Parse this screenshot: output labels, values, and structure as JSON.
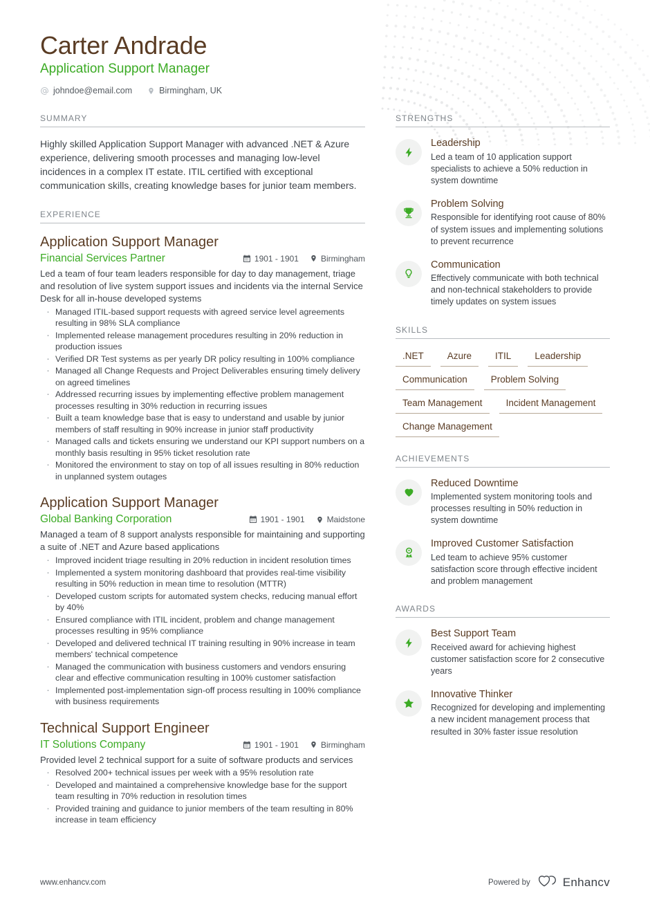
{
  "header": {
    "name": "Carter Andrade",
    "title": "Application Support Manager",
    "email": "johndoe@email.com",
    "email_icon": "at-icon",
    "location": "Birmingham, UK",
    "location_icon": "map-pin-icon"
  },
  "sections": {
    "summary_title": "SUMMARY",
    "experience_title": "EXPERIENCE",
    "strengths_title": "STRENGTHS",
    "skills_title": "SKILLS",
    "achievements_title": "ACHIEVEMENTS",
    "awards_title": "AWARDS"
  },
  "summary": {
    "text": "Highly skilled Application Support Manager with advanced .NET & Azure experience, delivering smooth processes and managing low-level incidences in a complex IT estate. ITIL certified with exceptional communication skills, creating knowledge bases for junior team members."
  },
  "experience": [
    {
      "role": "Application Support Manager",
      "company": "Financial Services Partner",
      "dates": "1901 - 1901",
      "location": "Birmingham",
      "description": "Led a team of four team leaders responsible for day to day management, triage and resolution of live system support issues and incidents via the internal Service Desk for all in-house developed systems",
      "bullets": [
        "Managed ITIL-based support requests with agreed service level agreements resulting in 98% SLA compliance",
        "Implemented release management procedures resulting in 20% reduction in production issues",
        "Verified DR Test systems as per yearly DR policy resulting in 100% compliance",
        "Managed all Change Requests and Project Deliverables ensuring timely delivery on agreed timelines",
        "Addressed recurring issues by implementing effective problem management processes resulting in 30% reduction in recurring issues",
        "Built a team knowledge base that is easy to understand and usable by junior members of staff resulting in 90% increase in junior staff productivity",
        "Managed calls and tickets ensuring we understand our KPI support numbers on a monthly basis resulting in 95% ticket resolution rate",
        "Monitored the environment to stay on top of all issues resulting in 80% reduction in unplanned system outages"
      ]
    },
    {
      "role": "Application Support Manager",
      "company": "Global Banking Corporation",
      "dates": "1901 - 1901",
      "location": "Maidstone",
      "description": "Managed a team of 8 support analysts responsible for maintaining and supporting a suite of .NET and Azure based applications",
      "bullets": [
        "Improved incident triage resulting in 20% reduction in incident resolution times",
        "Implemented a system monitoring dashboard that provides real-time visibility resulting in 50% reduction in mean time to resolution (MTTR)",
        "Developed custom scripts for automated system checks, reducing manual effort by 40%",
        "Ensured compliance with ITIL incident, problem and change management processes resulting in 95% compliance",
        "Developed and delivered technical IT training resulting in 90% increase in team members' technical competence",
        "Managed the communication with business customers and vendors ensuring clear and effective communication resulting in 100% customer satisfaction",
        "Implemented post-implementation sign-off process resulting in 100% compliance with business requirements"
      ]
    },
    {
      "role": "Technical Support Engineer",
      "company": "IT Solutions Company",
      "dates": "1901 - 1901",
      "location": "Birmingham",
      "description": "Provided level 2 technical support for a suite of software products and services",
      "bullets": [
        "Resolved 200+ technical issues per week with a 95% resolution rate",
        "Developed and maintained a comprehensive knowledge base for the support team resulting in 70% reduction in resolution times",
        "Provided training and guidance to junior members of the team resulting in 80% increase in team efficiency"
      ]
    }
  ],
  "strengths": [
    {
      "icon": "lightning-bolt-icon",
      "title": "Leadership",
      "description": "Led a team of 10 application support specialists to achieve a 50% reduction in system downtime"
    },
    {
      "icon": "trophy-icon",
      "title": "Problem Solving",
      "description": "Responsible for identifying root cause of 80% of system issues and implementing solutions to prevent recurrence"
    },
    {
      "icon": "lightbulb-icon",
      "title": "Communication",
      "description": "Effectively communicate with both technical and non-technical stakeholders to provide timely updates on system issues"
    }
  ],
  "skills": [
    ".NET",
    "Azure",
    "ITIL",
    "Leadership",
    "Communication",
    "Problem Solving",
    "Team Management",
    "Incident Management",
    "Change Management"
  ],
  "achievements": [
    {
      "icon": "heart-icon",
      "title": "Reduced Downtime",
      "description": "Implemented system monitoring tools and processes resulting in 50% reduction in system downtime"
    },
    {
      "icon": "award-ribbon-icon",
      "title": "Improved Customer Satisfaction",
      "description": "Led team to achieve 95% customer satisfaction score through effective incident and problem management"
    }
  ],
  "awards": [
    {
      "icon": "lightning-bolt-icon",
      "title": "Best Support Team",
      "description": "Received award for achieving highest customer satisfaction score for 2 consecutive years"
    },
    {
      "icon": "star-icon",
      "title": "Innovative Thinker",
      "description": "Recognized for developing and implementing a new incident management process that resulted in 30% faster issue resolution"
    }
  ],
  "footer": {
    "url": "www.enhancv.com",
    "powered_by": "Powered by",
    "brand": "Enhancv",
    "brand_icon": "enhancv-logo-icon"
  },
  "colors": {
    "accent_green": "#3cab25",
    "heading_brown": "#5a3c24",
    "body_gray": "#40454b",
    "rule_gray": "#b8bcc0",
    "badge_bg": "#f1f2f1"
  }
}
